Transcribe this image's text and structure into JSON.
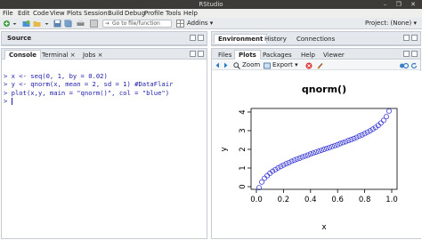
{
  "window": {
    "title": "RStudio",
    "controls": "– ❐ ✕"
  },
  "menu": [
    "File",
    "Edit",
    "Code",
    "View",
    "Plots",
    "Session",
    "Build",
    "Debug",
    "Profile",
    "Tools",
    "Help"
  ],
  "toolbar": {
    "goto_placeholder": "Go to file/function",
    "addins_label": "Addins ▾",
    "project_label": "Project: (None) ▾"
  },
  "source_pane": {
    "title": "Source"
  },
  "console_pane": {
    "tabs": [
      "Console",
      "Terminal ×",
      "Jobs ×"
    ],
    "lines": [
      "> x <- seq(0, 1, by = 0.02)",
      "> y <- qnorm(x, mean = 2, sd = 1) #DataFlair",
      "> plot(x,y, main = \"qnorm()\", col = \"blue\")",
      ">"
    ]
  },
  "env_pane": {
    "tabs": [
      "Environment",
      "History",
      "Connections"
    ]
  },
  "files_pane": {
    "tabs": [
      "Files",
      "Plots",
      "Packages",
      "Help",
      "Viewer"
    ],
    "zoom_label": "Zoom",
    "export_label": "Export ▾"
  },
  "colors": {
    "series": "#2a2ad0",
    "text": "#1a1aa6"
  },
  "chart_data": {
    "type": "scatter",
    "title": "qnorm()",
    "xlabel": "x",
    "ylabel": "y",
    "xlim": [
      0,
      1
    ],
    "ylim": [
      0,
      4
    ],
    "xticks": [
      "0.0",
      "0.2",
      "0.4",
      "0.6",
      "0.8",
      "1.0"
    ],
    "yticks": [
      "0",
      "1",
      "2",
      "3",
      "4"
    ],
    "series": [
      {
        "color": "blue",
        "x": [
          0.02,
          0.04,
          0.06,
          0.08,
          0.1,
          0.12,
          0.14,
          0.16,
          0.18,
          0.2,
          0.22,
          0.24,
          0.26,
          0.28,
          0.3,
          0.32,
          0.34,
          0.36,
          0.38,
          0.4,
          0.42,
          0.44,
          0.46,
          0.48,
          0.5,
          0.52,
          0.54,
          0.56,
          0.58,
          0.6,
          0.62,
          0.64,
          0.66,
          0.68,
          0.7,
          0.72,
          0.74,
          0.76,
          0.78,
          0.8,
          0.82,
          0.84,
          0.86,
          0.88,
          0.9,
          0.92,
          0.94,
          0.96,
          0.98
        ],
        "y": [
          -0.05,
          0.25,
          0.45,
          0.59,
          0.72,
          0.83,
          0.92,
          1.01,
          1.08,
          1.16,
          1.23,
          1.29,
          1.36,
          1.42,
          1.48,
          1.53,
          1.59,
          1.64,
          1.69,
          1.75,
          1.8,
          1.85,
          1.9,
          1.95,
          2.0,
          2.05,
          2.1,
          2.15,
          2.2,
          2.25,
          2.31,
          2.36,
          2.41,
          2.47,
          2.52,
          2.58,
          2.64,
          2.71,
          2.77,
          2.84,
          2.92,
          2.99,
          3.08,
          3.17,
          3.28,
          3.41,
          3.55,
          3.75,
          4.05
        ]
      }
    ]
  }
}
